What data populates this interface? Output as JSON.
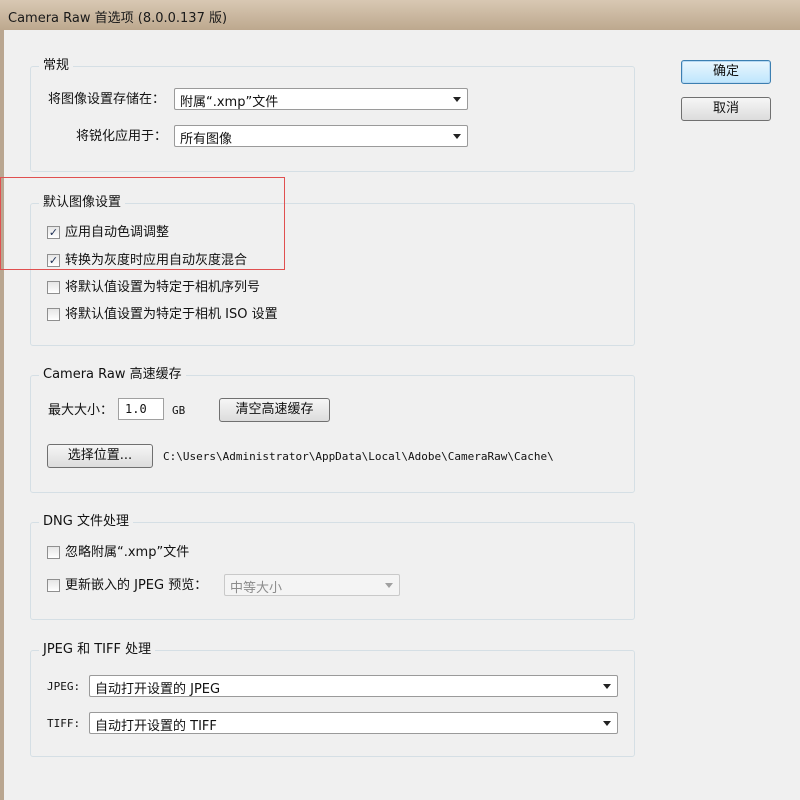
{
  "window": {
    "title": "Camera Raw 首选项 (8.0.0.137 版)"
  },
  "buttons": {
    "ok": "确定",
    "cancel": "取消"
  },
  "general": {
    "title": "常规",
    "save_settings_label": "将图像设置存储在：",
    "save_settings_value": "附属“.xmp”文件",
    "sharpening_label": "将锐化应用于：",
    "sharpening_value": "所有图像"
  },
  "default_settings": {
    "title": "默认图像设置",
    "options": [
      {
        "label": "应用自动色调调整",
        "checked": true
      },
      {
        "label": "转换为灰度时应用自动灰度混合",
        "checked": true
      },
      {
        "label": "将默认值设置为特定于相机序列号",
        "checked": false
      },
      {
        "label": "将默认值设置为特定于相机 ISO 设置",
        "checked": false
      }
    ]
  },
  "cache": {
    "title": "Camera Raw 高速缓存",
    "max_size_label": "最大大小：",
    "max_size_value": "1.0",
    "unit": "GB",
    "purge_button": "清空高速缓存",
    "select_location_button": "选择位置...",
    "path": "C:\\Users\\Administrator\\AppData\\Local\\Adobe\\CameraRaw\\Cache\\"
  },
  "dng": {
    "title": "DNG 文件处理",
    "ignore_sidecar": {
      "label": "忽略附属“.xmp”文件",
      "checked": false
    },
    "update_previews": {
      "label": "更新嵌入的 JPEG 预览：",
      "checked": false
    },
    "preview_size_value": "中等大小"
  },
  "jpeg_tiff": {
    "title": "JPEG 和 TIFF 处理",
    "jpeg_label": "JPEG:",
    "jpeg_value": "自动打开设置的 JPEG",
    "tiff_label": "TIFF:",
    "tiff_value": "自动打开设置的 TIFF"
  },
  "colors": {
    "highlight_box": "#e05050",
    "titlebar": "#c9b79f",
    "client_bg": "#f0f0f0"
  },
  "icons": [
    "chevron-down-icon",
    "checkmark-icon"
  ]
}
